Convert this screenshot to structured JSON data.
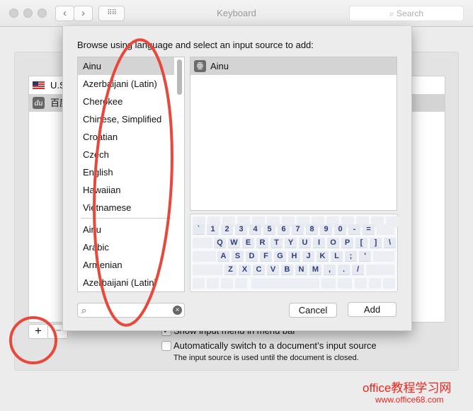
{
  "window": {
    "title": "Keyboard",
    "search_placeholder": "Search"
  },
  "sources": [
    {
      "flag": "us-flag-icon",
      "label": "U.S."
    },
    {
      "flag": "baidu-icon",
      "icon_text": "du",
      "label": "百度"
    }
  ],
  "options": {
    "show_menu": {
      "label": "Show input menu in menu bar",
      "checked": true
    },
    "auto_switch": {
      "label": "Automatically switch to a document’s input source",
      "checked": false,
      "note": "The input source is used until the document is closed."
    }
  },
  "sheet": {
    "prompt": "Browse using language and select an input source to add:",
    "languages": [
      "Ainu",
      "Azerbaijani (Latin)",
      "Cherokee",
      "Chinese, Simplified",
      "Croatian",
      "Czech",
      "English",
      "Hawaiian",
      "Vietnamese",
      "Ainu",
      "Arabic",
      "Armenian",
      "Azerbaijani (Latin)"
    ],
    "selected_language": "Ainu",
    "input_sources": [
      {
        "label": "Ainu",
        "icon": "ainu-icon"
      }
    ],
    "keyboard_rows": [
      [
        "`",
        "1",
        "2",
        "3",
        "4",
        "5",
        "6",
        "7",
        "8",
        "9",
        "0",
        "-",
        "="
      ],
      [
        "Q",
        "W",
        "E",
        "R",
        "T",
        "Y",
        "U",
        "I",
        "O",
        "P",
        "[",
        "]",
        "\\"
      ],
      [
        "A",
        "S",
        "D",
        "F",
        "G",
        "H",
        "J",
        "K",
        "L",
        ";",
        "'"
      ],
      [
        "Z",
        "X",
        "C",
        "V",
        "B",
        "N",
        "M",
        ",",
        ".",
        "/"
      ]
    ],
    "search_value": "",
    "cancel_label": "Cancel",
    "add_label": "Add"
  },
  "buttons": {
    "add": "+",
    "remove": "−"
  },
  "watermark": {
    "line1": "office教程学习网",
    "line2": "www.office68.com"
  },
  "annotation_color": "#e8473a"
}
